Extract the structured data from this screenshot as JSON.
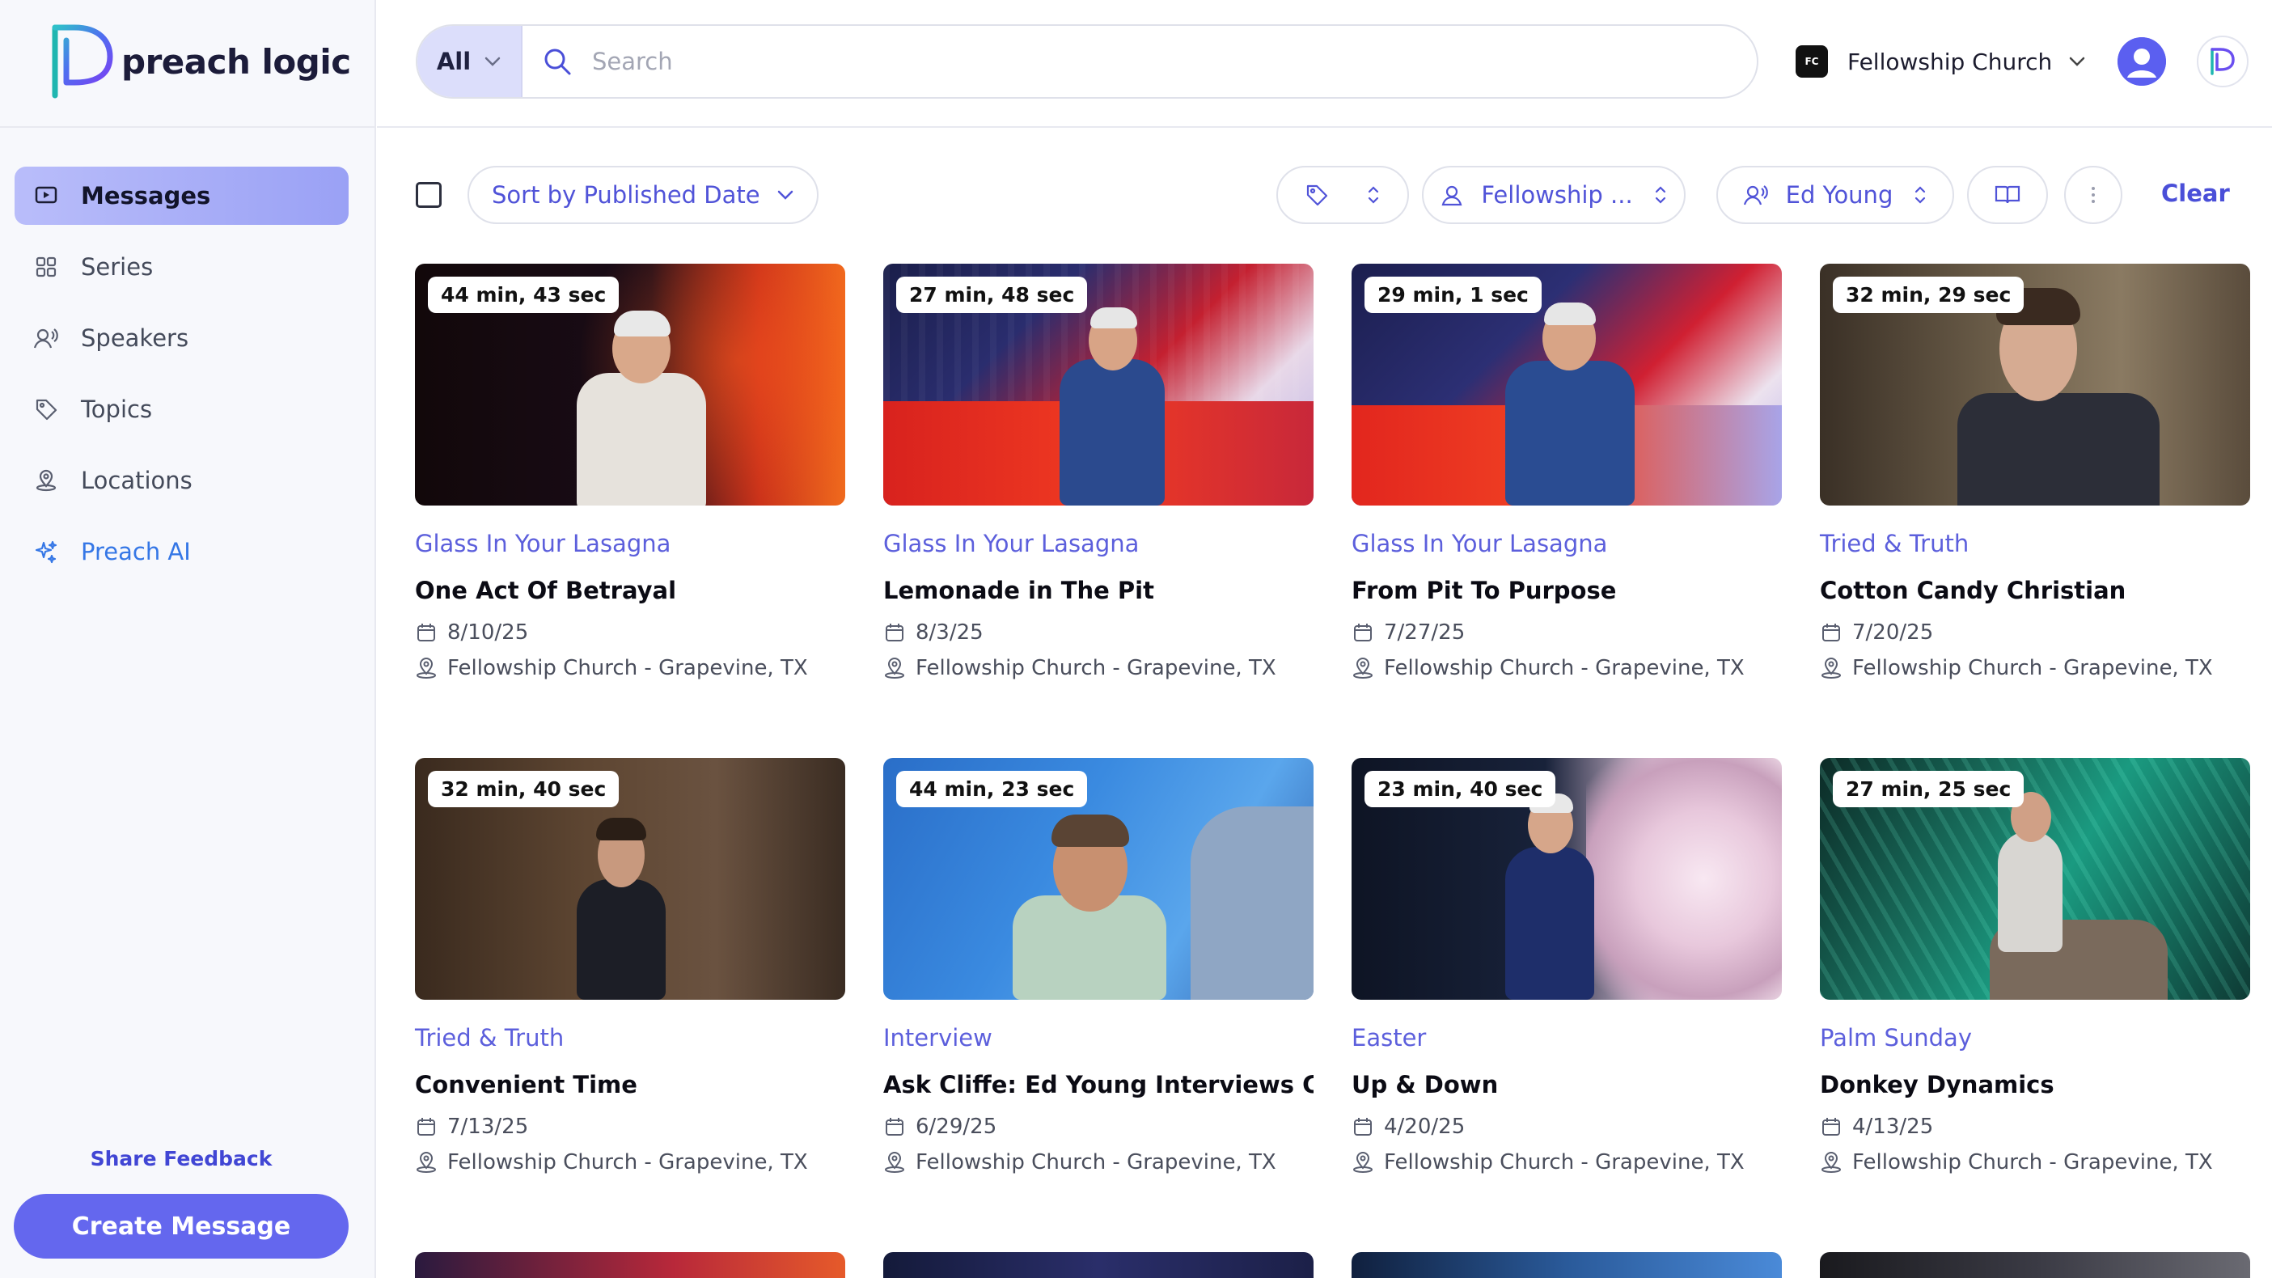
{
  "brand": {
    "name": "preach logic"
  },
  "sidebar": {
    "items": [
      {
        "label": "Messages",
        "icon": "messages-icon",
        "active": true
      },
      {
        "label": "Series",
        "icon": "grid-icon"
      },
      {
        "label": "Speakers",
        "icon": "speaker-icon"
      },
      {
        "label": "Topics",
        "icon": "tag-icon"
      },
      {
        "label": "Locations",
        "icon": "location-icon"
      },
      {
        "label": "Preach AI",
        "icon": "sparkle-icon"
      }
    ],
    "share_feedback": "Share Feedback",
    "create_message": "Create Message"
  },
  "header": {
    "scope": "All",
    "search_placeholder": "Search",
    "church_badge": "FC",
    "church": "Fellowship Church"
  },
  "toolbar": {
    "sort_label": "Sort by Published Date",
    "location_filter": "Fellowship ...",
    "speaker_filter": "Ed Young",
    "clear": "Clear"
  },
  "colors": {
    "accent": "#5c5fdc",
    "primary_button": "#6467ee",
    "active_nav": "#a9aef8"
  },
  "messages": [
    {
      "duration": "44 min, 43 sec",
      "series": "Glass In Your Lasagna",
      "title": "One Act Of Betrayal",
      "date": "8/10/25",
      "location": "Fellowship Church - Grapevine, TX"
    },
    {
      "duration": "27 min, 48 sec",
      "series": "Glass In Your Lasagna",
      "title": "Lemonade in The Pit",
      "date": "8/3/25",
      "location": "Fellowship Church - Grapevine, TX"
    },
    {
      "duration": "29 min, 1 sec",
      "series": "Glass In Your Lasagna",
      "title": "From Pit To Purpose",
      "date": "7/27/25",
      "location": "Fellowship Church - Grapevine, TX"
    },
    {
      "duration": "32 min, 29 sec",
      "series": "Tried & Truth",
      "title": "Cotton Candy Christian",
      "date": "7/20/25",
      "location": "Fellowship Church - Grapevine, TX"
    },
    {
      "duration": "32 min, 40 sec",
      "series": "Tried & Truth",
      "title": "Convenient Time",
      "date": "7/13/25",
      "location": "Fellowship Church - Grapevine, TX"
    },
    {
      "duration": "44 min, 23 sec",
      "series": "Interview",
      "title": "Ask Cliffe: Ed Young Interviews Cliffe Knechtle",
      "date": "6/29/25",
      "location": "Fellowship Church - Grapevine, TX"
    },
    {
      "duration": "23 min, 40 sec",
      "series": "Easter",
      "title": "Up & Down",
      "date": "4/20/25",
      "location": "Fellowship Church - Grapevine, TX"
    },
    {
      "duration": "27 min, 25 sec",
      "series": "Palm Sunday",
      "title": "Donkey Dynamics",
      "date": "4/13/25",
      "location": "Fellowship Church - Grapevine, TX"
    }
  ]
}
